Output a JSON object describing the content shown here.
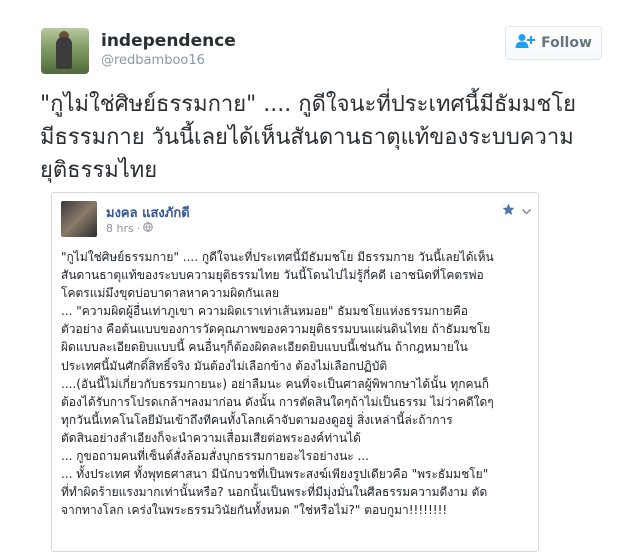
{
  "profile": {
    "display_name": "independence",
    "handle": "@redbamboo16",
    "avatar_icon": "profile-photo"
  },
  "follow_button": {
    "label": "Follow",
    "icon": "add-user-icon"
  },
  "tweet": {
    "lines": [
      "\"กูไม่ใช่ศิษย์ธรรมกาย\" .... กูดีใจนะที่ประเทศนี้มีธัมมชโย",
      "มีธรรมกาย  วันนี้เลยได้เห็นสันดานธาตุแท้ของระบบความ",
      "ยุติธรรมไทย"
    ]
  },
  "embedded_post": {
    "author": "มงคล แสงภักดี",
    "time": "8 hrs",
    "meta_separator": "·",
    "star_icon": "star-icon",
    "chevron_icon": "chevron-down-icon",
    "globe_icon": "globe-icon",
    "lines": [
      "\"กูไม่ใช่ศิษย์ธรรมกาย\" .... กูดีใจนะที่ประเทศนี้มีธัมมชโย มีธรรมกาย วันนี้เลยได้เห็น",
      "สันดานธาตุแท้ของระบบความยุติธรรมไทย วันนี้โดนไปไม่รู้กี่คดี เอาชนิดที่โคตรพ่อ",
      "โคตรแม่มึงขุดบ่อบาดาลหาความผิดกันเลย",
      "... \"ความผิดผู้อื่นเท่าภูเขา ความผิดเราเท่าเส้นหมอย\" ธัมมชโยแห่งธรรมกายคือ",
      "ตัวอย่าง คือต้นแบบของการวัดคุณภาพของความยุติธรรมบนแผ่นดินไทย ถ้าธัมมชโย",
      "ผิดแบบละเอียดยิบแบบนี้ คนอื่นๆก็ต้องผิดละเอียดยิบแบบนี้เช่นกัน ถ้ากฎหมายใน",
      "ประเทศนี้มันศักดิ์สิทธิ์จริง มันต้องไม่เลือกข้าง ต้องไม่เลือกปฏิบัติ",
      "....(อันนี้ไม่เกี่ยวกับธรรมกายนะ) อย่าลืมนะ คนที่จะเป็นศาลผู้พิพากษาได้นั้น ทุกคนก็",
      "ต้องได้รับการโปรดเกล้าฯลงมาก่อน ดังนั้น การตัดสินใดๆถ้าไม่เป็นธรรม ไม่ว่าคดีใดๆ",
      "ทุกวันนี้เทคโนโลยีมันเข้าถึงทีคนทั้งโลกเค้าจับตามองดูอยู่ สิ่งเหล่านี้ล่ะถ้าการ",
      "ตัดสินอย่างลำเอียงก็จะนำความเสื่อมเสียต่อพระองค์ท่านได้",
      "... กูขอถามคนที่เซ็นต์สั่งล้อมสั่งบุกธรรมกายอะไรอย่างนะ ...",
      "... ทั้งประเทศ ทั้งพุทธศาสนา มีนักบวชที่เป็นพระสงฆ์เพียงรูปเดียวคือ \"พระธัมมชโย\"",
      "ที่ทำผิดร้ายแรงมากเท่านั้นหรือ? นอกนั้นเป็นพระที่มีมุ่งมั่นในศีลธรรมความดีงาม ตัด",
      "จากทางโลก เคร่งในพระธรรมวินัยกันทั้งหมด \"ใช่หรือไม่?\" ตอบกูมา!!!!!!!!"
    ]
  },
  "colors": {
    "text": "#292f33",
    "muted": "#8899a6",
    "fb_blue": "#365899",
    "star_blue": "#4a76a8"
  }
}
